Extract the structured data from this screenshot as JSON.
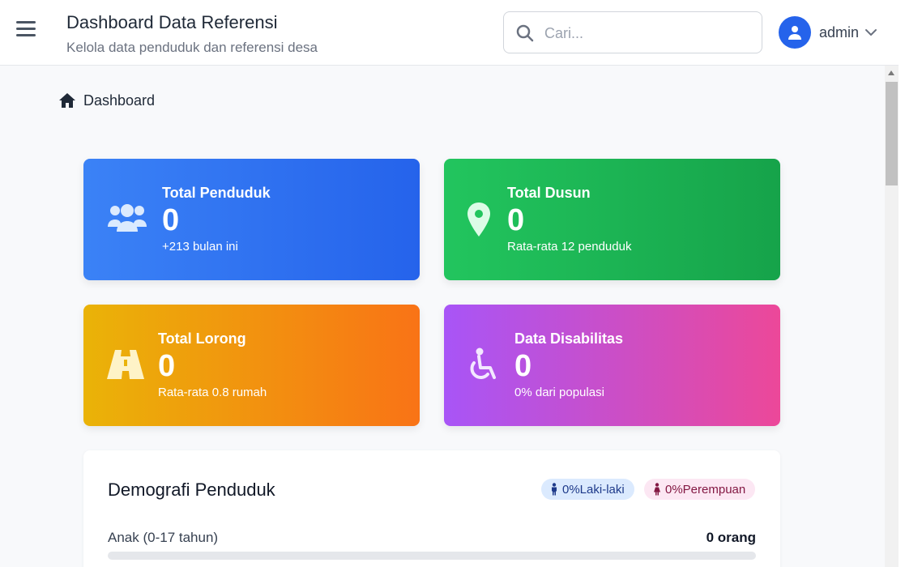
{
  "header": {
    "title": "Dashboard Data Referensi",
    "subtitle": "Kelola data penduduk dan referensi desa",
    "search_placeholder": "Cari...",
    "username": "admin"
  },
  "breadcrumb": {
    "label": "Dashboard"
  },
  "cards": [
    {
      "label": "Total Penduduk",
      "value": "0",
      "note": "+213 bulan ini",
      "icon": "users-icon"
    },
    {
      "label": "Total Dusun",
      "value": "0",
      "note": "Rata-rata 12 penduduk",
      "icon": "map-pin-icon"
    },
    {
      "label": "Total Lorong",
      "value": "0",
      "note": "Rata-rata 0.8 rumah",
      "icon": "road-icon"
    },
    {
      "label": "Data Disabilitas",
      "value": "0",
      "note": "0% dari populasi",
      "icon": "wheelchair-icon"
    }
  ],
  "demographics": {
    "title": "Demografi Penduduk",
    "male_badge": "0%Laki-laki",
    "female_badge": "0%Perempuan",
    "rows": [
      {
        "label": "Anak (0-17 tahun)",
        "value": "0 orang",
        "fraction": 0
      }
    ]
  },
  "colors": {
    "accent": "#2563eb",
    "card_blue": "#3b82f6",
    "card_green": "#22c55e",
    "card_orange": "#f97316",
    "card_pink": "#ec4899"
  }
}
